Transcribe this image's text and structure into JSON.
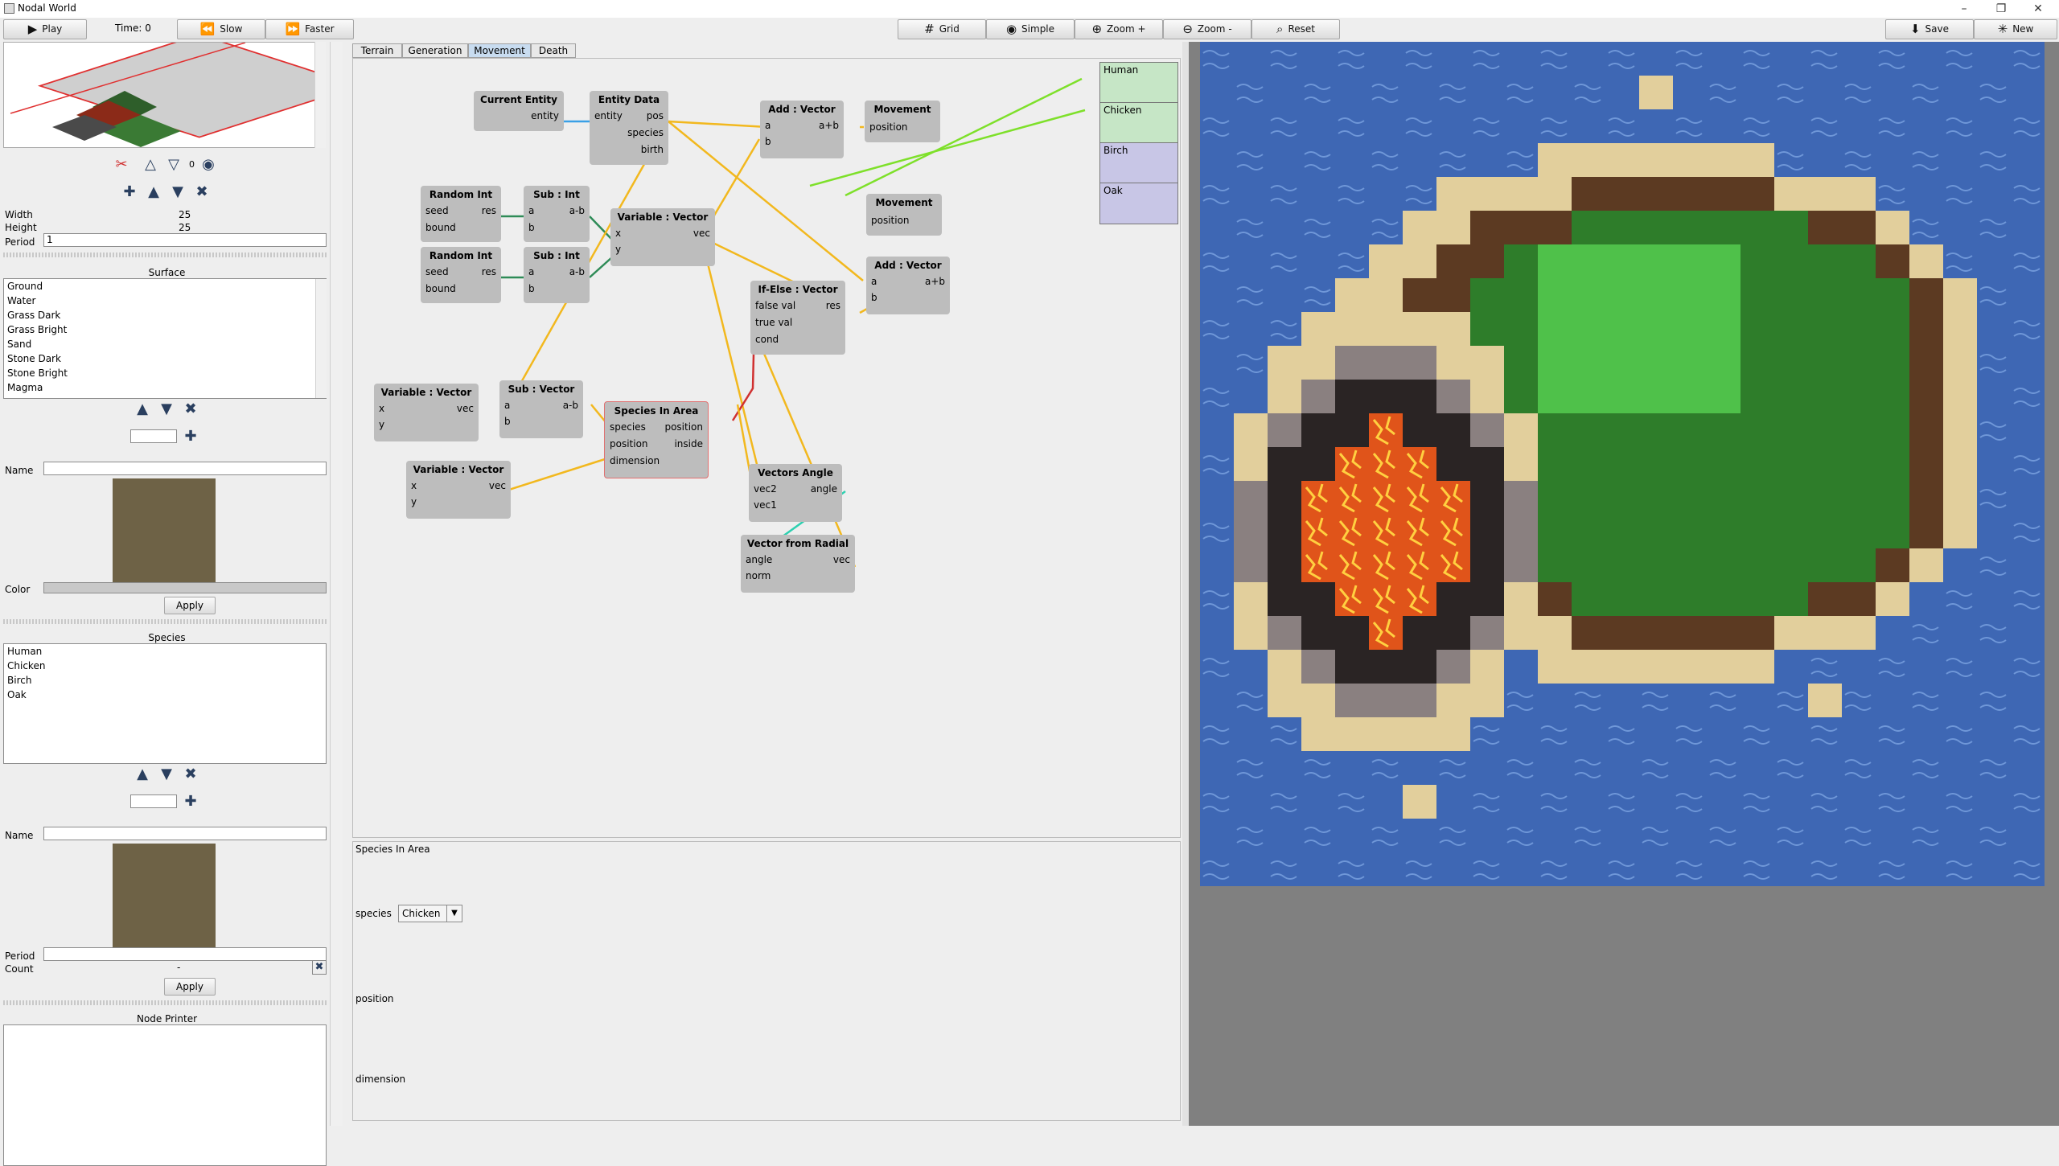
{
  "window": {
    "title": "Nodal World"
  },
  "toolbar": {
    "play": "Play",
    "time": "Time: 0",
    "slow": "Slow",
    "faster": "Faster",
    "grid": "Grid",
    "simple": "Simple",
    "zoom_in": "Zoom +",
    "zoom_out": "Zoom -",
    "reset": "Reset",
    "save": "Save",
    "new": "New"
  },
  "world": {
    "layer_value": "0",
    "width_label": "Width",
    "width_value": "25",
    "height_label": "Height",
    "height_value": "25",
    "period_label": "Period",
    "period_value": "1"
  },
  "surface": {
    "title": "Surface",
    "items": [
      "Ground",
      "Water",
      "Grass Dark",
      "Grass Bright",
      "Sand",
      "Stone Dark",
      "Stone Bright",
      "Magma"
    ],
    "name_label": "Name",
    "color_label": "Color",
    "swatch_color": "#6e6246",
    "apply": "Apply"
  },
  "species": {
    "title": "Species",
    "items": [
      "Human",
      "Chicken",
      "Birch",
      "Oak"
    ],
    "name_label": "Name",
    "swatch_color": "#6e6246",
    "period_label": "Period",
    "count_label": "Count",
    "count_value": "-",
    "apply": "Apply"
  },
  "node_printer": {
    "title": "Node Printer"
  },
  "tabs": [
    "Terrain",
    "Generation",
    "Movement",
    "Death"
  ],
  "active_tab": "Movement",
  "nodes": {
    "current_entity": {
      "title": "Current Entity",
      "entity": "entity"
    },
    "entity_data": {
      "title": "Entity Data",
      "entity": "entity",
      "pos": "pos",
      "species": "species",
      "birth": "birth"
    },
    "add_vector_1": {
      "title": "Add : Vector",
      "a": "a",
      "b": "b",
      "out": "a+b"
    },
    "movement_1": {
      "title": "Movement",
      "position": "position"
    },
    "random_int_1": {
      "title": "Random Int",
      "seed": "seed",
      "bound": "bound",
      "res": "res"
    },
    "sub_int_1": {
      "title": "Sub : Int",
      "a": "a",
      "b": "b",
      "out": "a-b"
    },
    "random_int_2": {
      "title": "Random Int",
      "seed": "seed",
      "bound": "bound",
      "res": "res"
    },
    "sub_int_2": {
      "title": "Sub : Int",
      "a": "a",
      "b": "b",
      "out": "a-b"
    },
    "variable_vector_1": {
      "title": "Variable : Vector",
      "x": "x",
      "y": "y",
      "vec": "vec"
    },
    "movement_2": {
      "title": "Movement",
      "position": "position"
    },
    "add_vector_2": {
      "title": "Add : Vector",
      "a": "a",
      "b": "b",
      "out": "a+b"
    },
    "if_else": {
      "title": "If-Else : Vector",
      "false_val": "false val",
      "true_val": "true val",
      "cond": "cond",
      "res": "res"
    },
    "variable_vector_2": {
      "title": "Variable : Vector",
      "x": "x",
      "y": "y",
      "vec": "vec"
    },
    "sub_vector": {
      "title": "Sub : Vector",
      "a": "a",
      "b": "b",
      "out": "a-b"
    },
    "species_in_area": {
      "title": "Species In Area",
      "species": "species",
      "position": "position",
      "dimension": "dimension",
      "out_position": "position",
      "inside": "inside"
    },
    "variable_vector_3": {
      "title": "Variable : Vector",
      "x": "x",
      "y": "y",
      "vec": "vec"
    },
    "vectors_angle": {
      "title": "Vectors Angle",
      "vec2": "vec2",
      "vec1": "vec1",
      "angle": "angle"
    },
    "vector_from_radial": {
      "title": "Vector from Radial",
      "angle": "angle",
      "norm": "norm",
      "vec": "vec"
    }
  },
  "legend": [
    {
      "label": "Human",
      "color": "#c6e6c6"
    },
    {
      "label": "Chicken",
      "color": "#c6e6c6"
    },
    {
      "label": "Birch",
      "color": "#c8c6e6"
    },
    {
      "label": "Oak",
      "color": "#c8c6e6"
    }
  ],
  "inspector": {
    "title": "Species In Area",
    "species_label": "species",
    "species_value": "Chicken",
    "position_label": "position",
    "dimension_label": "dimension"
  },
  "colors": {
    "wire_yellow": "#f2b81e",
    "wire_blue": "#3aa0e6",
    "wire_green": "#2e8b57",
    "wire_lime": "#7ee02a",
    "wire_red": "#d03030",
    "wire_teal": "#2ed0b0",
    "water": "#3e67b4",
    "sand": "#e2cf9c",
    "ground": "#5c3a22",
    "grass_dark": "#2e7d2a",
    "grass_bright": "#4fc14a",
    "stone_dark": "#2a2424",
    "stone_bright": "#8a8080",
    "magma": "#e0541a"
  }
}
